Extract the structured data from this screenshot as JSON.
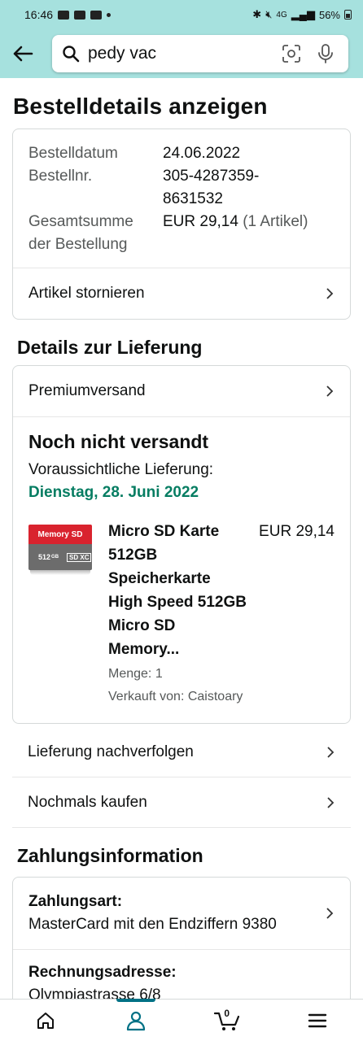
{
  "status_bar": {
    "time": "16:46",
    "battery": "56%",
    "network": "4G"
  },
  "search": {
    "query": "pedy vac"
  },
  "page": {
    "title": "Bestelldetails anzeigen"
  },
  "order": {
    "date_label": "Bestelldatum",
    "date_value": "24.06.2022",
    "number_label": "Bestellnr.",
    "number_value_line1": "305-4287359-",
    "number_value_line2": "8631532",
    "total_label_line1": "Gesamtsumme",
    "total_label_line2": "der Bestellung",
    "total_value": "EUR 29,14",
    "total_items": "(1 Artikel)",
    "cancel_label": "Artikel stornieren"
  },
  "delivery": {
    "section_title": "Details zur Lieferung",
    "shipping_method": "Premiumversand",
    "status": "Noch nicht versandt",
    "estimate_label": "Voraussichtliche Lieferung:",
    "estimate_date": "Dienstag, 28. Juni 2022",
    "accent_color": "#067d62"
  },
  "product": {
    "image_top_text": "Memory SD",
    "image_bottom_text": "512",
    "image_bottom_unit": "GB",
    "image_badge": "SD XC",
    "title": "Micro SD Karte 512GB Speicherkarte High Speed 512GB Micro SD Memory...",
    "price": "EUR 29,14",
    "quantity": "Menge: 1",
    "seller": "Verkauft von: Caistoary"
  },
  "actions": {
    "track": "Lieferung nachverfolgen",
    "buy_again": "Nochmals kaufen"
  },
  "payment": {
    "section_title": "Zahlungsinformation",
    "method_label": "Zahlungsart:",
    "method_value": "MasterCard mit den Endziffern 9380",
    "address_label": "Rechnungsadresse:",
    "address_value": "Olympiastrasse 6/8"
  },
  "nav": {
    "cart_count": "0",
    "items": [
      "home-icon",
      "account-icon",
      "cart-icon",
      "menu-icon"
    ],
    "active_color": "#007185"
  }
}
